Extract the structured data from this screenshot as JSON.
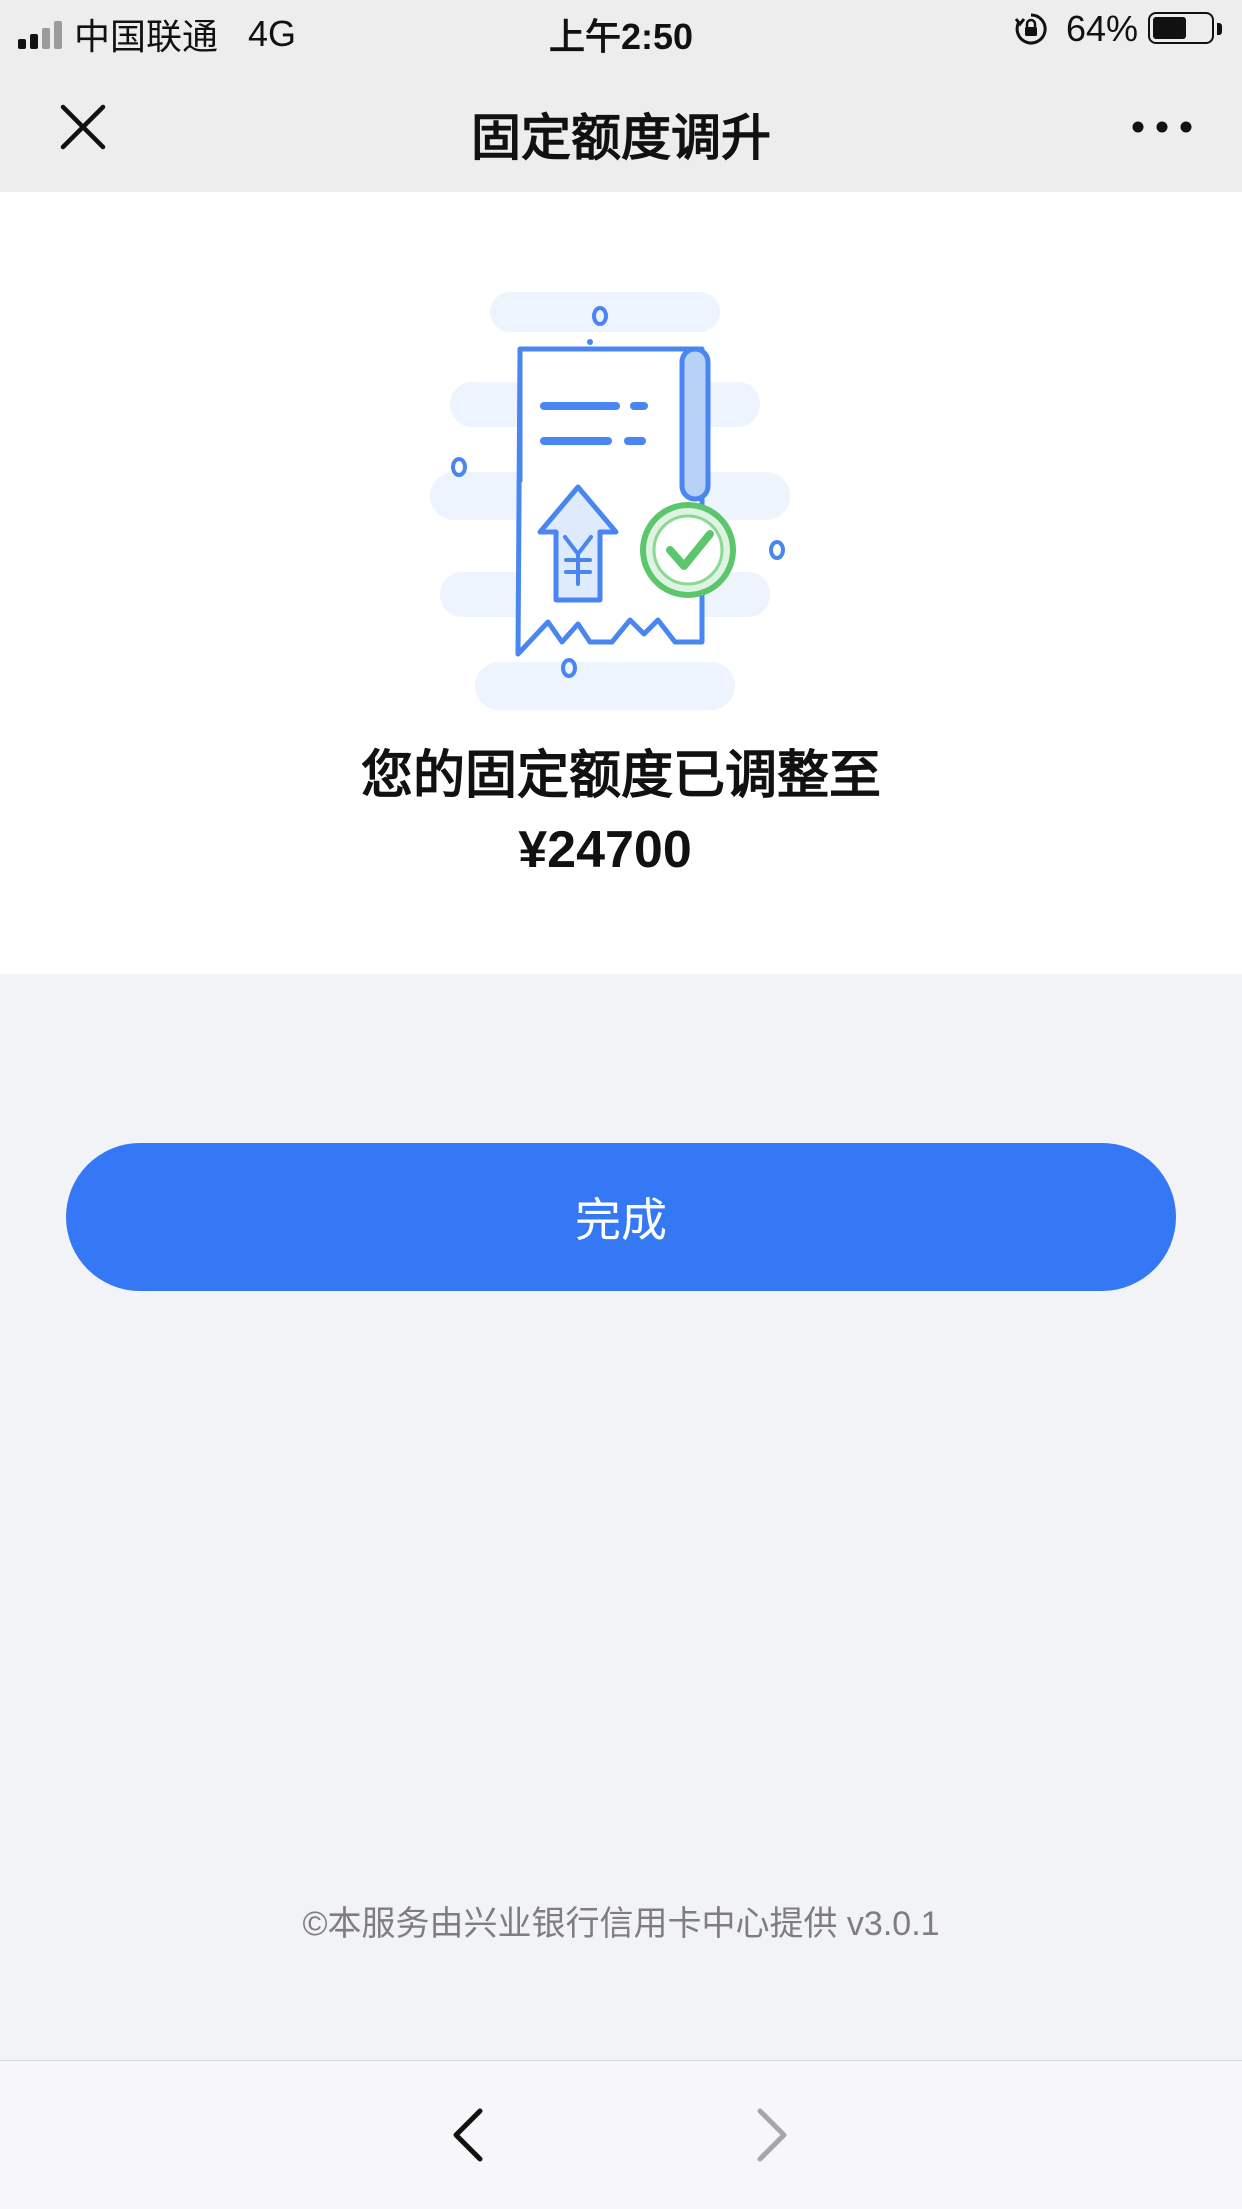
{
  "status_bar": {
    "carrier": "中国联通",
    "network": "4G",
    "time": "上午2:50",
    "battery": "64%",
    "battery_level": 0.64,
    "icons": [
      "signal-icon",
      "rotation-lock-icon",
      "battery-icon"
    ]
  },
  "nav": {
    "title": "固定额度调升",
    "close_icon": "close-icon",
    "more_icon": "more-icon"
  },
  "result": {
    "illustration": "credit-limit-success-illustration",
    "message": "您的固定额度已调整至",
    "amount": "¥24700"
  },
  "actions": {
    "done_label": "完成"
  },
  "footer": {
    "note": "©本服务由兴业银行信用卡中心提供 v3.0.1"
  },
  "toolbar": {
    "back_icon": "chevron-left-icon",
    "forward_icon": "chevron-right-icon"
  },
  "colors": {
    "accent": "#3478f6",
    "success": "#5cc66c",
    "background": "#f2f3f7"
  }
}
